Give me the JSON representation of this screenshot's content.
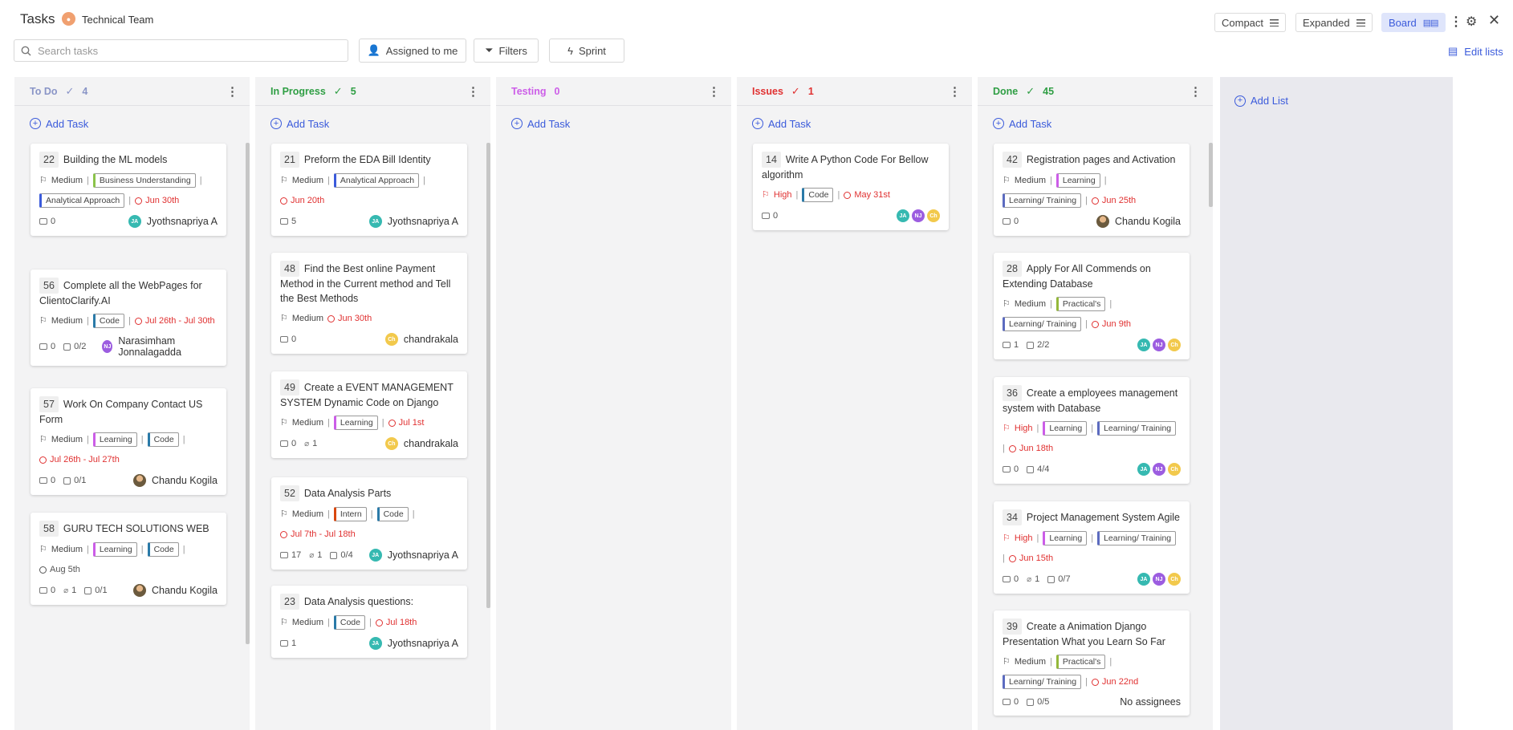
{
  "header": {
    "title": "Tasks",
    "team": "Technical Team",
    "views": {
      "compact": "Compact",
      "expanded": "Expanded",
      "board": "Board"
    },
    "search_placeholder": "Search tasks",
    "assigned": "Assigned to me",
    "filters": "Filters",
    "sprint": "Sprint",
    "edit_lists": "Edit lists",
    "add_list": "Add List"
  },
  "colors": {
    "accent": "#3b5bdb",
    "high": "#e03131",
    "todo": "#8a95c7",
    "inprogress": "#2f9e44",
    "testing": "#cc5de8",
    "issues": "#e03131",
    "done": "#2f9e44"
  },
  "add_task_label": "Add Task",
  "columns": [
    {
      "name": "To Do",
      "count": "4",
      "cards": [
        {
          "num": "22",
          "title": "Building the ML models",
          "priority": "Medium",
          "tags": [
            "Business Understanding",
            "Analytical Approach"
          ],
          "date": "Jun 30th",
          "comments": "0",
          "assignee": "Jyothsnapriya A"
        },
        {
          "num": "56",
          "title": "Complete all the WebPages for ClientoClarify.AI",
          "priority": "Medium",
          "tags": [
            "Code"
          ],
          "date": "Jul 26th - Jul 30th",
          "comments": "0",
          "checks": "0/2",
          "assignee": "Narasimham Jonnalagadda"
        },
        {
          "num": "57",
          "title": "Work On Company Contact US Form",
          "priority": "Medium",
          "tags": [
            "Learning",
            "Code"
          ],
          "date": "Jul 26th - Jul 27th",
          "comments": "0",
          "checks": "0/1",
          "assignee": "Chandu Kogila"
        },
        {
          "num": "58",
          "title": "GURU TECH SOLUTIONS WEB",
          "priority": "Medium",
          "tags": [
            "Learning",
            "Code"
          ],
          "date": "Aug 5th",
          "comments": "0",
          "attachments": "1",
          "checks": "0/1",
          "assignee": "Chandu Kogila"
        }
      ]
    },
    {
      "name": "In Progress",
      "count": "5",
      "cards": [
        {
          "num": "21",
          "title": "Preform the EDA Bill Identity",
          "priority": "Medium",
          "tags": [
            "Analytical Approach"
          ],
          "date": "Jun 20th",
          "comments": "5",
          "assignee": "Jyothsnapriya A"
        },
        {
          "num": "48",
          "title": "Find the Best online Payment Method in the Current method and Tell the Best Methods",
          "priority": "Medium",
          "date": "Jun 30th",
          "comments": "0",
          "assignee": "chandrakala"
        },
        {
          "num": "49",
          "title": "Create a EVENT MANAGEMENT SYSTEM Dynamic Code on Django",
          "priority": "Medium",
          "tags": [
            "Learning"
          ],
          "date": "Jul 1st",
          "comments": "0",
          "attachments": "1",
          "assignee": "chandrakala"
        },
        {
          "num": "52",
          "title": "Data Analysis Parts",
          "priority": "Medium",
          "tags": [
            "Intern",
            "Code"
          ],
          "date": "Jul 7th - Jul 18th",
          "comments": "17",
          "attachments": "1",
          "checks": "0/4",
          "assignee": "Jyothsnapriya A"
        },
        {
          "num": "23",
          "title": "Data Analysis questions:",
          "priority": "Medium",
          "tags": [
            "Code"
          ],
          "date": "Jul 18th",
          "comments": "1",
          "assignee": "Jyothsnapriya A"
        }
      ]
    },
    {
      "name": "Testing",
      "count": "0",
      "cards": []
    },
    {
      "name": "Issues",
      "count": "1",
      "cards": [
        {
          "num": "14",
          "title": "Write A Python Code For Bellow algorithm",
          "priority": "High",
          "tags": [
            "Code"
          ],
          "date": "May 31st",
          "comments": "0"
        }
      ]
    },
    {
      "name": "Done",
      "count": "45",
      "cards": [
        {
          "num": "42",
          "title": "Registration pages and Activation",
          "priority": "Medium",
          "tags": [
            "Learning",
            "Learning/ Training"
          ],
          "date": "Jun 25th",
          "comments": "0",
          "assignee": "Chandu Kogila"
        },
        {
          "num": "28",
          "title": "Apply For All Commends on Extending Database",
          "priority": "Medium",
          "tags": [
            "Practical's",
            "Learning/ Training"
          ],
          "date": "Jun 9th",
          "comments": "1",
          "checks": "2/2"
        },
        {
          "num": "36",
          "title": "Create a employees management system with Database",
          "priority": "High",
          "tags": [
            "Learning",
            "Learning/ Training"
          ],
          "date": "Jun 18th",
          "comments": "0",
          "checks": "4/4"
        },
        {
          "num": "34",
          "title": "Project Management System Agile",
          "priority": "High",
          "tags": [
            "Learning",
            "Learning/ Training"
          ],
          "date": "Jun 15th",
          "comments": "0",
          "attachments": "1",
          "checks": "0/7"
        },
        {
          "num": "39",
          "title": "Create a Animation Django Presentation What you Learn So Far",
          "priority": "Medium",
          "tags": [
            "Practical's",
            "Learning/ Training"
          ],
          "date": "Jun 22nd",
          "comments": "0",
          "checks": "0/5",
          "assignee": "No assignees"
        }
      ]
    }
  ],
  "avatars": {
    "ja": "JA",
    "nj": "NJ",
    "ch": "Ch"
  }
}
